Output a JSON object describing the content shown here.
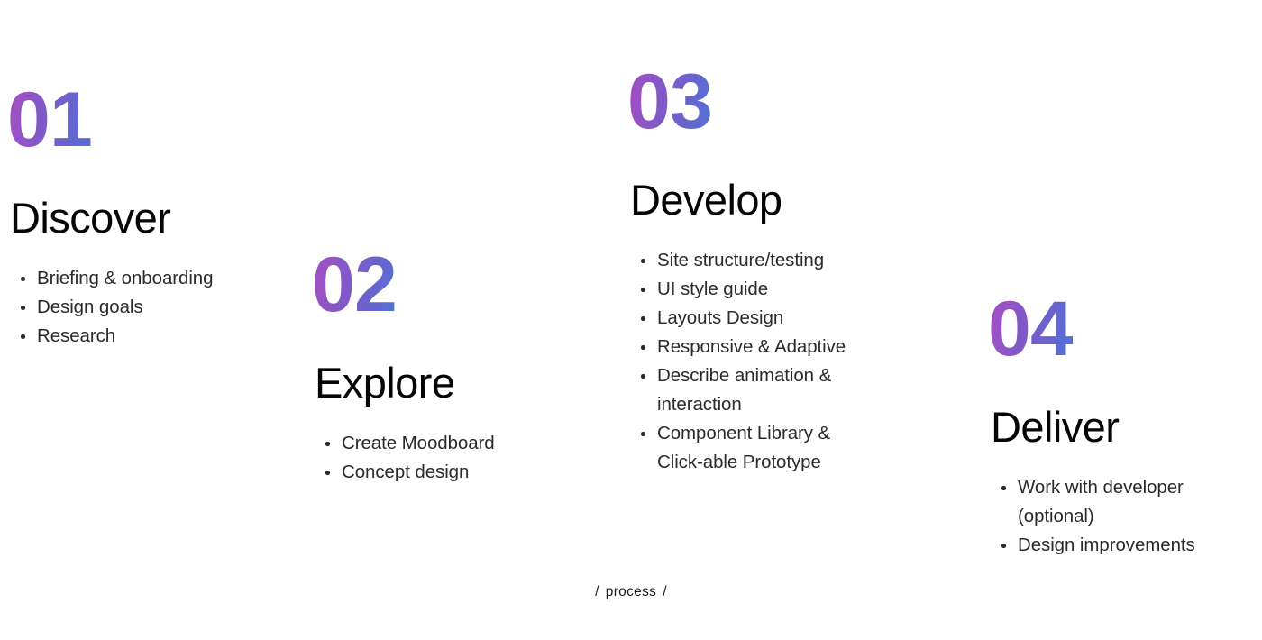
{
  "page": {
    "background_color": "#ffffff",
    "heading_color": "#050505",
    "list_text_color": "#2b2b2b",
    "gradient_start_color": "#a24ec0",
    "gradient_end_color": "#556fd4"
  },
  "steps": [
    {
      "number": "01",
      "title": "Discover",
      "items": [
        "Briefing & onboarding",
        "Design goals",
        "Research"
      ]
    },
    {
      "number": "02",
      "title": "Explore",
      "items": [
        "Create Moodboard",
        "Concept design"
      ]
    },
    {
      "number": "03",
      "title": "Develop",
      "items": [
        "Site structure/testing",
        "UI style guide",
        "Layouts Design",
        "Responsive & Adaptive",
        "Describe animation & interaction",
        "Component Library & Click-able Prototype"
      ]
    },
    {
      "number": "04",
      "title": "Deliver",
      "items": [
        "Work with developer (optional)",
        "Design improvements"
      ]
    }
  ],
  "footer": {
    "left_slash": "/",
    "label": "process",
    "right_slash": "/"
  }
}
